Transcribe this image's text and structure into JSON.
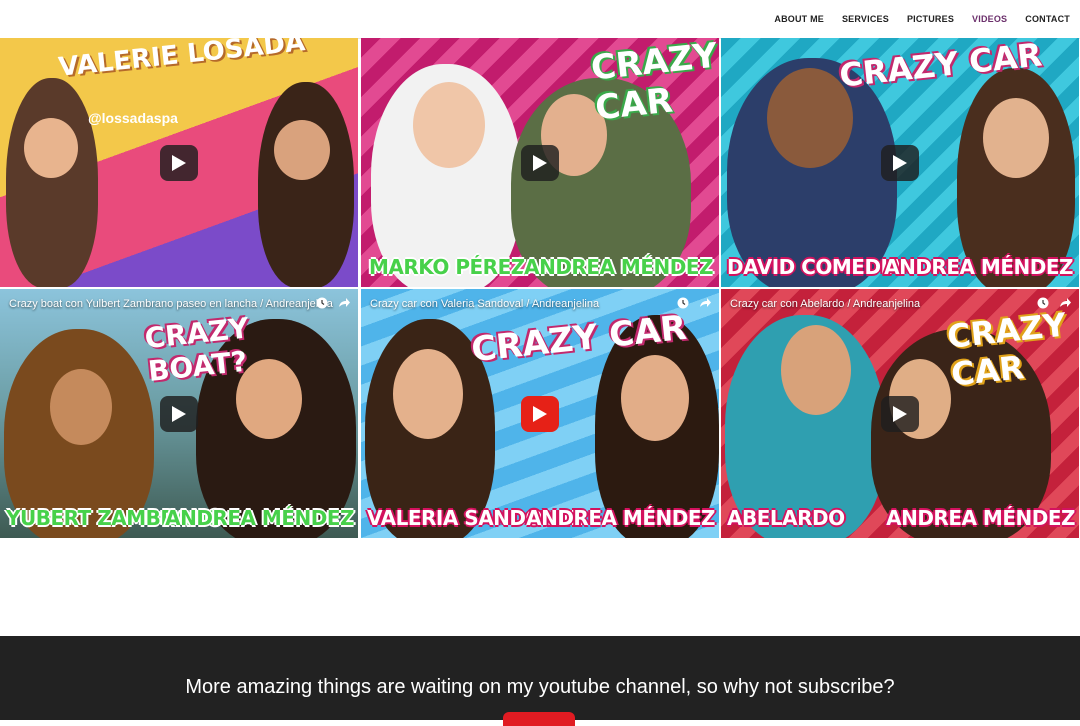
{
  "nav": {
    "items": [
      {
        "label": "ABOUT ME"
      },
      {
        "label": "SERVICES"
      },
      {
        "label": "PICTURES"
      },
      {
        "label": "VIDEOS"
      },
      {
        "label": "CONTACT"
      }
    ],
    "active_item": "VIDEOS",
    "active_color": "#6b2f6b"
  },
  "videos": [
    {
      "title": "",
      "logo_text": "VALERIE LOSADA",
      "handle": "@lossadaspa",
      "names": [
        "",
        ""
      ],
      "play_icon": "play-icon"
    },
    {
      "title": "",
      "logo_text": "CRAZY CAR",
      "names": [
        "MARKO PÉREZ",
        "ANDREA MÉNDEZ"
      ],
      "play_icon": "play-icon"
    },
    {
      "title": "",
      "logo_text": "CRAZY CAR",
      "names": [
        "DAVID COMEDIA",
        "ANDREA MÉNDEZ"
      ],
      "play_icon": "play-icon"
    },
    {
      "title": "Crazy boat con Yulbert Zambrano paseo en lancha / Andreanjelina",
      "logo_text": "CRAZY BOAT?",
      "names": [
        "YUBERT ZAMBRANO",
        "ANDREA MÉNDEZ"
      ],
      "play_icon": "play-icon"
    },
    {
      "title": "Crazy car con Valeria Sandoval / Andreanjelina",
      "logo_text": "CRAZY CAR",
      "names": [
        "VALERIA SANDOVAL",
        "ANDREA MÉNDEZ"
      ],
      "play_icon": "youtube-play-icon"
    },
    {
      "title": "Crazy car con Abelardo / Andreanjelina",
      "logo_text": "CRAZY CAR",
      "names": [
        "ABELARDO",
        "ANDREA MÉNDEZ"
      ],
      "play_icon": "play-icon"
    }
  ],
  "footer": {
    "message": "More amazing things are waiting on my youtube channel, so why not subscribe?",
    "button_color": "#e11b22"
  }
}
